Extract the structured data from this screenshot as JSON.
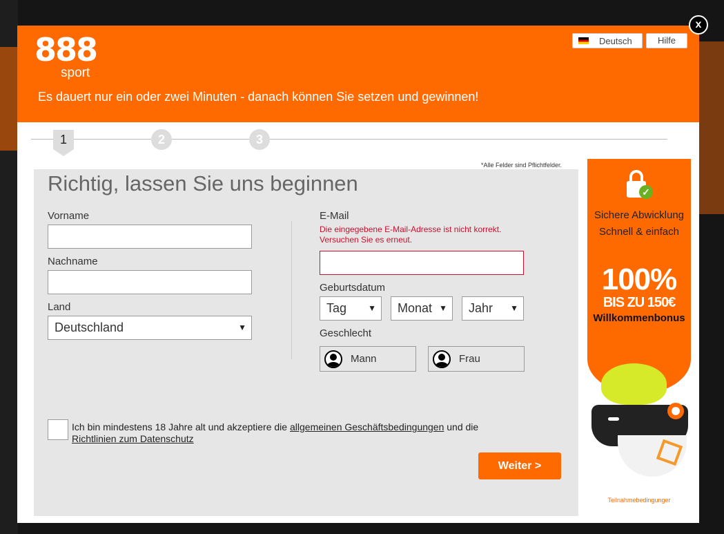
{
  "header": {
    "logo_number": "888",
    "logo_word": "sport",
    "tagline": "Es dauert nur ein oder zwei Minuten - danach können Sie setzen und gewinnen!",
    "language_label": "Deutsch",
    "help_label": "Hilfe",
    "close_label": "x"
  },
  "steps": [
    "1",
    "2",
    "3"
  ],
  "required_note": "*Alle Felder sind Pflichtfelder.",
  "form": {
    "title": "Richtig, lassen Sie uns beginnen",
    "first_name_label": "Vorname",
    "first_name_value": "",
    "last_name_label": "Nachname",
    "last_name_value": "",
    "country_label": "Land",
    "country_value": "Deutschland",
    "email_label": "E-Mail",
    "email_error": "Die eingegebene E-Mail-Adresse ist nicht korrekt. Versuchen Sie es erneut.",
    "email_value": "",
    "birthdate_label": "Geburtsdatum",
    "day_value": "Tag",
    "month_value": "Monat",
    "year_value": "Jahr",
    "gender_label": "Geschlecht",
    "male_label": "Mann",
    "female_label": "Frau",
    "terms_prefix": "Ich bin mindestens 18 Jahre alt und akzeptiere die ",
    "terms_link1": "allgemeinen Geschäftsbedingungen",
    "terms_mid": " und die ",
    "terms_link2": "Richtlinien zum Datenschutz",
    "next_label": "Weiter >"
  },
  "promo": {
    "secure_line1": "Sichere Abwicklung",
    "secure_line2": "Schnell & einfach",
    "percent": "100%",
    "upto": "BIS ZU 150€",
    "bonus": "Willkommenbonus",
    "terms": "Teilnahmebedingunger"
  },
  "colors": {
    "brand_orange": "#ff6a00",
    "error_red": "#c8102e"
  }
}
